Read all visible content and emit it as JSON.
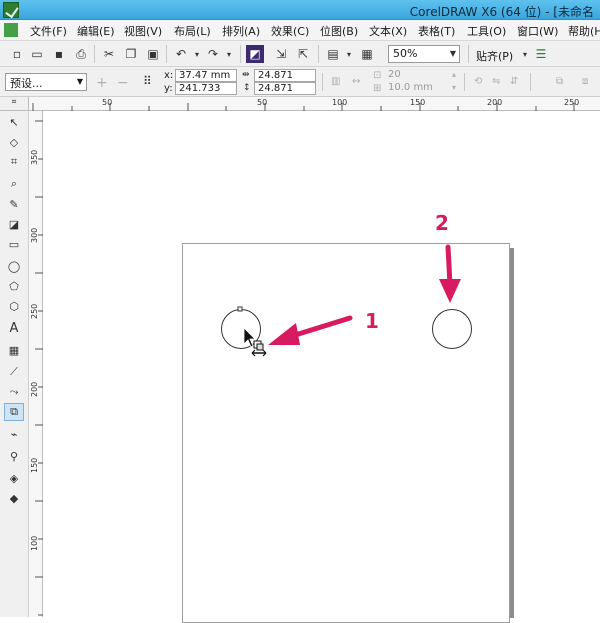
{
  "window": {
    "title": "CorelDRAW X6 (64 位) - [未命名"
  },
  "menu": {
    "items": [
      "文件(F)",
      "编辑(E)",
      "视图(V)",
      "布局(L)",
      "排列(A)",
      "效果(C)",
      "位图(B)",
      "文本(X)",
      "表格(T)",
      "工具(O)",
      "窗口(W)",
      "帮助(H)"
    ]
  },
  "toolbar": {
    "zoom_value": "50%",
    "snap_label": "贴齐(P)"
  },
  "property_bar": {
    "preset_value": "预设...",
    "x_label": "x:",
    "y_label": "y:",
    "x_value": "37.47 mm",
    "y_value": "241.733 mm",
    "width_value": "24.871 mm",
    "height_value": "24.871 mm",
    "grey_value_1": "20",
    "grey_value_2": "10.0 mm"
  },
  "rulers": {
    "top_ticks": [
      "50",
      "50",
      "100",
      "150",
      "200",
      "250"
    ],
    "left_ticks": [
      "350",
      "300",
      "250",
      "200",
      "150",
      "100"
    ]
  },
  "annotations": {
    "label_1": "1",
    "label_2": "2"
  },
  "colors": {
    "title_bar": "#3aa6dc",
    "annotation": "#d81b60",
    "active_tool": "#cde4f7"
  },
  "icons": {
    "app": "coreldraw-logo-icon",
    "cursor": "arrow-cursor-icon"
  }
}
